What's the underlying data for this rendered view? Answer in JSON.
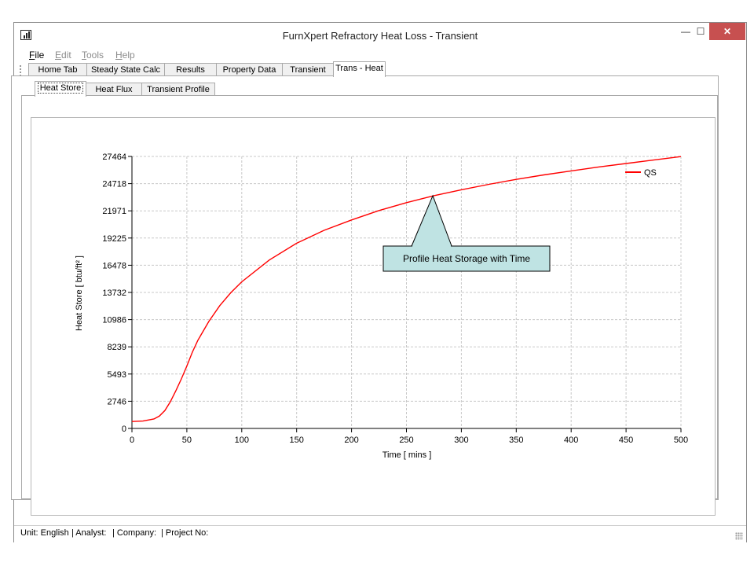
{
  "window": {
    "title": "FurnXpert Refractory Heat Loss - Transient",
    "minimize_glyph": "—",
    "maximize_glyph": "☐",
    "close_glyph": "✕"
  },
  "menu": {
    "file": {
      "underlined": "F",
      "rest": "ile"
    },
    "edit": {
      "underlined": "E",
      "rest": "dit"
    },
    "tools": {
      "underlined": "T",
      "rest": "ools"
    },
    "help": {
      "underlined": "H",
      "rest": "elp"
    }
  },
  "toolbar": {
    "icons": [
      "new-document-icon",
      "open-folder-icon",
      "save-icon",
      "print-icon",
      "help-icon",
      "export-excel-icon"
    ]
  },
  "tabs": [
    {
      "label": "Home Tab"
    },
    {
      "label": "Steady State Calc"
    },
    {
      "label": "Results"
    },
    {
      "label": "Property Data"
    },
    {
      "label": "Transient"
    },
    {
      "label": "Trans - Heat"
    }
  ],
  "active_tab": "Trans - Heat",
  "subtabs": [
    {
      "label": "Heat Store"
    },
    {
      "label": "Heat Flux"
    },
    {
      "label": "Transient Profile"
    }
  ],
  "active_subtab": "Heat Store",
  "chart_data": {
    "type": "line",
    "title": "",
    "xlabel": "Time [ mins ]",
    "ylabel": "Heat Store [ btu/ft² ]",
    "xlim": [
      0,
      500
    ],
    "ylim": [
      0,
      27464
    ],
    "x_ticks": [
      "0",
      "50",
      "100",
      "150",
      "200",
      "250",
      "300",
      "350",
      "400",
      "450",
      "500"
    ],
    "y_ticks": [
      "0",
      "2746",
      "5493",
      "8239",
      "10986",
      "13732",
      "16478",
      "19225",
      "21971",
      "24718",
      "27464"
    ],
    "grid": true,
    "legend_position": "top-right",
    "series": [
      {
        "name": "QS",
        "color": "#ff0000",
        "x": [
          0,
          10,
          20,
          25,
          30,
          35,
          40,
          45,
          50,
          55,
          60,
          70,
          80,
          90,
          100,
          125,
          150,
          175,
          200,
          225,
          250,
          275,
          300,
          325,
          350,
          375,
          400,
          425,
          450,
          475,
          500
        ],
        "y": [
          700,
          750,
          950,
          1250,
          1800,
          2700,
          3800,
          5000,
          6300,
          7700,
          8900,
          10800,
          12400,
          13700,
          14800,
          17000,
          18700,
          20000,
          21050,
          22000,
          22800,
          23500,
          24100,
          24650,
          25150,
          25600,
          26000,
          26400,
          26750,
          27100,
          27450
        ]
      }
    ],
    "annotation": {
      "text": "Profile Heat Storage with Time",
      "x": 274,
      "y": 23500,
      "fill": "#bfe3e3"
    }
  },
  "status": {
    "unit": "Unit: English",
    "analyst": "| Analyst:",
    "company": "| Company:",
    "project": "| Project No:"
  }
}
